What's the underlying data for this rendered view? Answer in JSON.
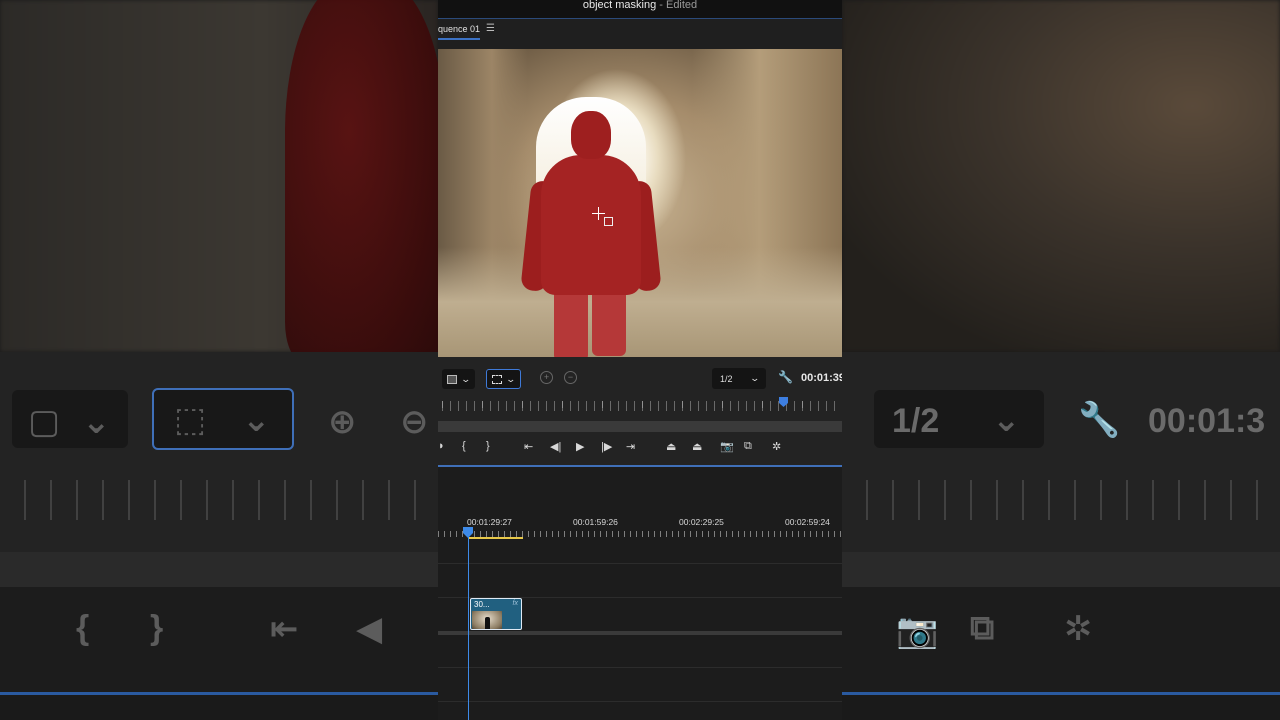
{
  "window": {
    "title": "object masking",
    "status": " - Edited"
  },
  "tabs": {
    "sequence_label": "quence 01",
    "menu_glyph": "☰"
  },
  "monitor": {
    "mask_mode_dropdown": "Overlay mask view",
    "selection_tool": "Rectangle selection",
    "resolution": "1/2",
    "timecode": "00:01:39"
  },
  "transport": {
    "mark_in": "{",
    "mark_out": "}",
    "go_to_in": "⇤",
    "step_back": "◀|",
    "play": "▶",
    "step_forward": "|▶",
    "go_to_out": "⇥"
  },
  "timeline": {
    "timecodes": [
      "00:01:29:27",
      "00:01:59:26",
      "00:02:29:25",
      "00:02:59:24"
    ],
    "clip": {
      "name": "30...",
      "fx": "fx"
    }
  },
  "background": {
    "res": "1/2",
    "timecode": "00:01:3"
  },
  "colors": {
    "accent": "#3f7ad8",
    "mask": "#a52323",
    "clip": "#216080",
    "in_out": "#e8c84a"
  }
}
